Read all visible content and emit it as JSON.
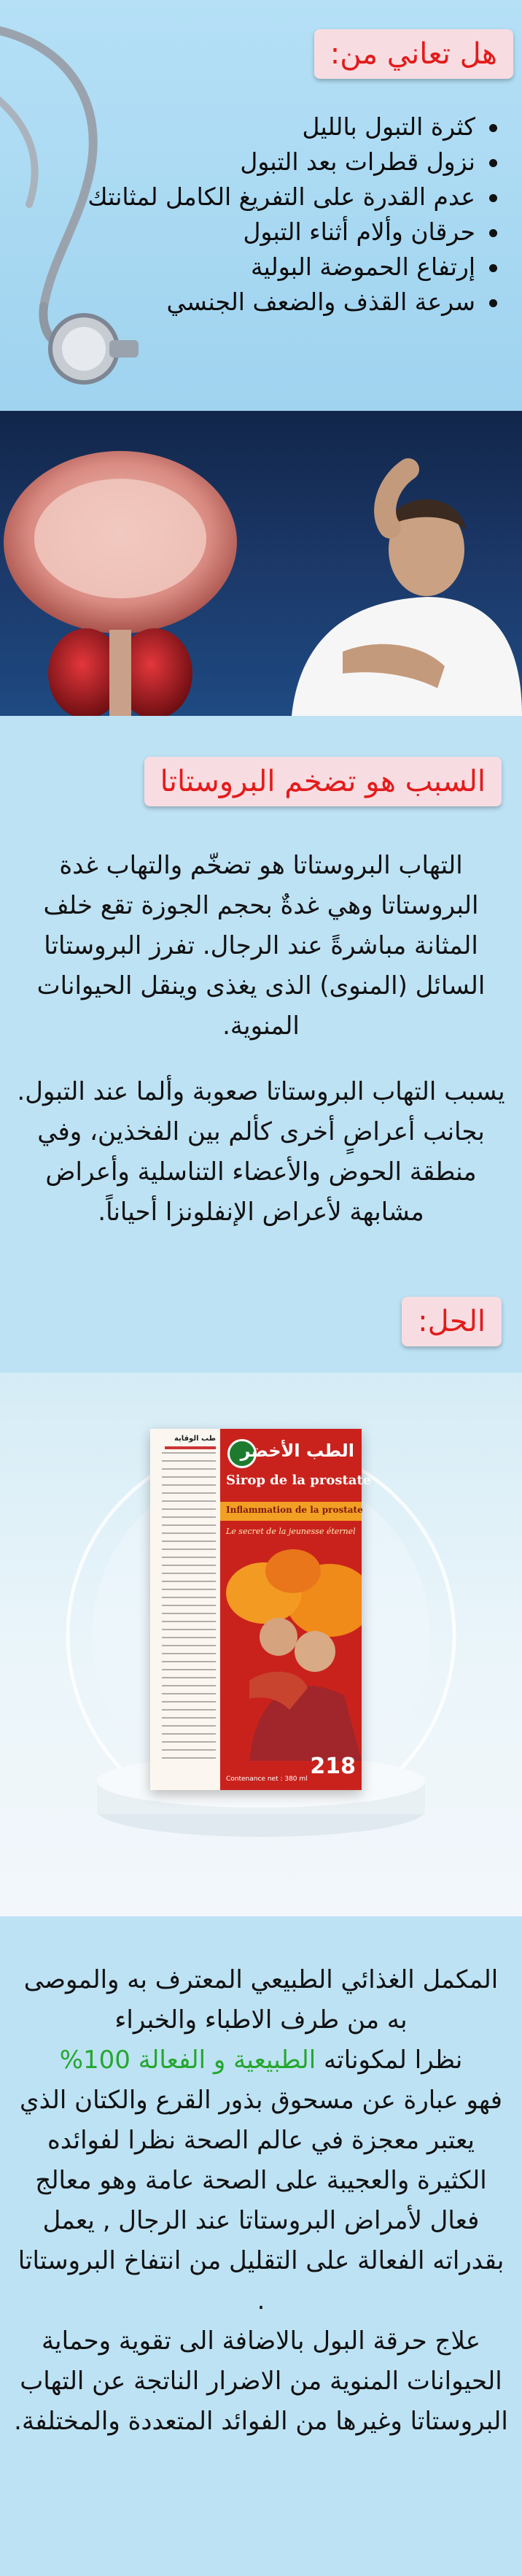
{
  "symptoms": {
    "heading": "هل تعاني من:",
    "items": [
      "كثرة التبول بالليل",
      "نزول قطرات بعد التبول",
      "عدم القدرة على التفريغ الكامل لمثانتك",
      "حرقان وألام أثناء التبول",
      "إرتفاع الحموضة البولية",
      "سرعة القذف والضعف الجنسي"
    ]
  },
  "cause": {
    "heading": "السبب هو تضخم البروستاتا",
    "paragraph_1": "التهاب البروستاتا هو تضخّم والتهاب غدة البروستاتا وهي غدةٌ بحجم الجوزة تقع خلف المثانة مباشرةً عند الرجال. تفرز البروستاتا السائل (المنوى) الذى يغذى وينقل الحيوانات المنوية.",
    "paragraph_2": "يسبب التهاب البروستاتا صعوبة وألما عند التبول. بجانب أعراضٍ أخرى كألم بين الفخذين، وفي منطقة الحوض والأعضاء التناسلية وأعراض مشابهة لأعراض الإنفلونزا أحياناً."
  },
  "solution": {
    "heading": "الحل:"
  },
  "product": {
    "brand_arabic": "الطب الأخضر",
    "name": "Sirop de la prostate",
    "subtitle": "Inflammation de la prostate",
    "tagline": "Le secret de la jeunesse éternel",
    "contenance": "Contenance net : 380 ml",
    "code": "218",
    "side_header": "طب الوقاية"
  },
  "description": {
    "line_1": "المكمل الغذائي الطبيعي المعترف به والموصى به من طرف الاطباء والخبراء",
    "line_2_before": "نظرا لمكوناته ",
    "line_2_green": "الطبيعية و الفعالة 100%",
    "body": "فهو عبارة عن مسحوق بذور القرع والكتان الذي يعتبر معجزة في عالم الصحة نظرا لفوائده الكثيرة والعجيبة على الصحة عامة وهو معالج فعال لأمراض البروستاتا عند الرجال , يعمل بقدراته الفعالة على التقليل من انتفاخ البروستاتا .",
    "ending": "علاج حرقة البول بالاضافة الى تقوية وحماية الحيوانات المنوية من الاضرار الناتجة عن التهاب البروستاتا وغيرها من الفوائد المتعددة والمختلفة."
  },
  "colors": {
    "heading_red": "#e31b1b",
    "heading_box": "#f7dde1",
    "background": "#bde2f4",
    "accent_green": "#25a72d"
  }
}
